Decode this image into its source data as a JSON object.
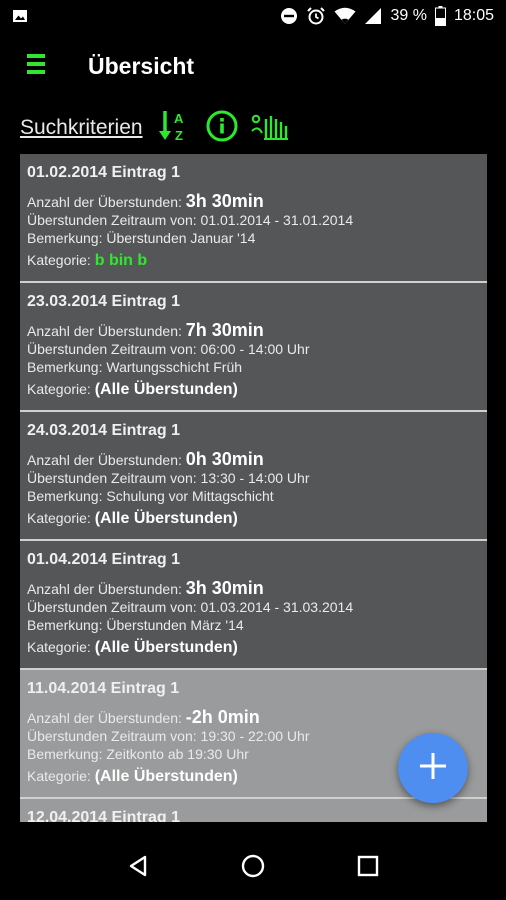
{
  "status_bar": {
    "battery_percent": "39 %",
    "time": "18:05",
    "icons": [
      "image-icon",
      "dnd-icon",
      "alarm-icon",
      "wifi-icon",
      "signal-icon",
      "battery-icon"
    ]
  },
  "app_bar": {
    "title": "Übersicht",
    "menu_icon": "menu-icon"
  },
  "toolbar": {
    "search_label": "Suchkriterien",
    "icons": [
      "sort-az-icon",
      "info-icon",
      "gesture-icon"
    ]
  },
  "entries": [
    {
      "date": "01.02.2014 Eintrag 1",
      "hours_label": "Anzahl der Überstunden:",
      "hours": "3h 30min",
      "range": "Überstunden Zeitraum von: 01.01.2014 - 31.01.2014",
      "note": "Bemerkung: Überstunden Januar '14",
      "category_label": "Kategorie:",
      "category": "b bin b"
    },
    {
      "date": "23.03.2014 Eintrag 1",
      "hours_label": "Anzahl der Überstunden:",
      "hours": "7h 30min",
      "range": "Überstunden Zeitraum von: 06:00 - 14:00 Uhr",
      "note": "Bemerkung: Wartungsschicht Früh",
      "category_label": "Kategorie:",
      "category": "(Alle Überstunden)"
    },
    {
      "date": "24.03.2014 Eintrag 1",
      "hours_label": "Anzahl der Überstunden:",
      "hours": "0h 30min",
      "range": "Überstunden Zeitraum von: 13:30 - 14:00 Uhr",
      "note": "Bemerkung: Schulung vor Mittagschicht",
      "category_label": "Kategorie:",
      "category": "(Alle Überstunden)"
    },
    {
      "date": "01.04.2014 Eintrag 1",
      "hours_label": "Anzahl der Überstunden:",
      "hours": "3h 30min",
      "range": "Überstunden Zeitraum von: 01.03.2014 - 31.03.2014",
      "note": "Bemerkung: Überstunden März '14",
      "category_label": "Kategorie:",
      "category": "(Alle Überstunden)"
    },
    {
      "date": "11.04.2014 Eintrag 1",
      "hours_label": "Anzahl der Überstunden:",
      "hours": "-2h 0min",
      "range": "Überstunden Zeitraum von: 19:30 - 22:00 Uhr",
      "note": "Bemerkung: Zeitkonto ab 19:30 Uhr",
      "category_label": "Kategorie:",
      "category": "(Alle Überstunden)"
    },
    {
      "date": "12.04.2014 Eintrag 1"
    }
  ],
  "fab": {
    "icon": "plus-icon"
  },
  "nav_bar": {
    "icons": [
      "back-icon",
      "home-icon",
      "recents-icon"
    ]
  },
  "colors": {
    "accent_green": "#2ee82e",
    "fab_blue": "#4e8ef0",
    "entry_dark": "#555657",
    "entry_light": "#9a9b9c"
  }
}
